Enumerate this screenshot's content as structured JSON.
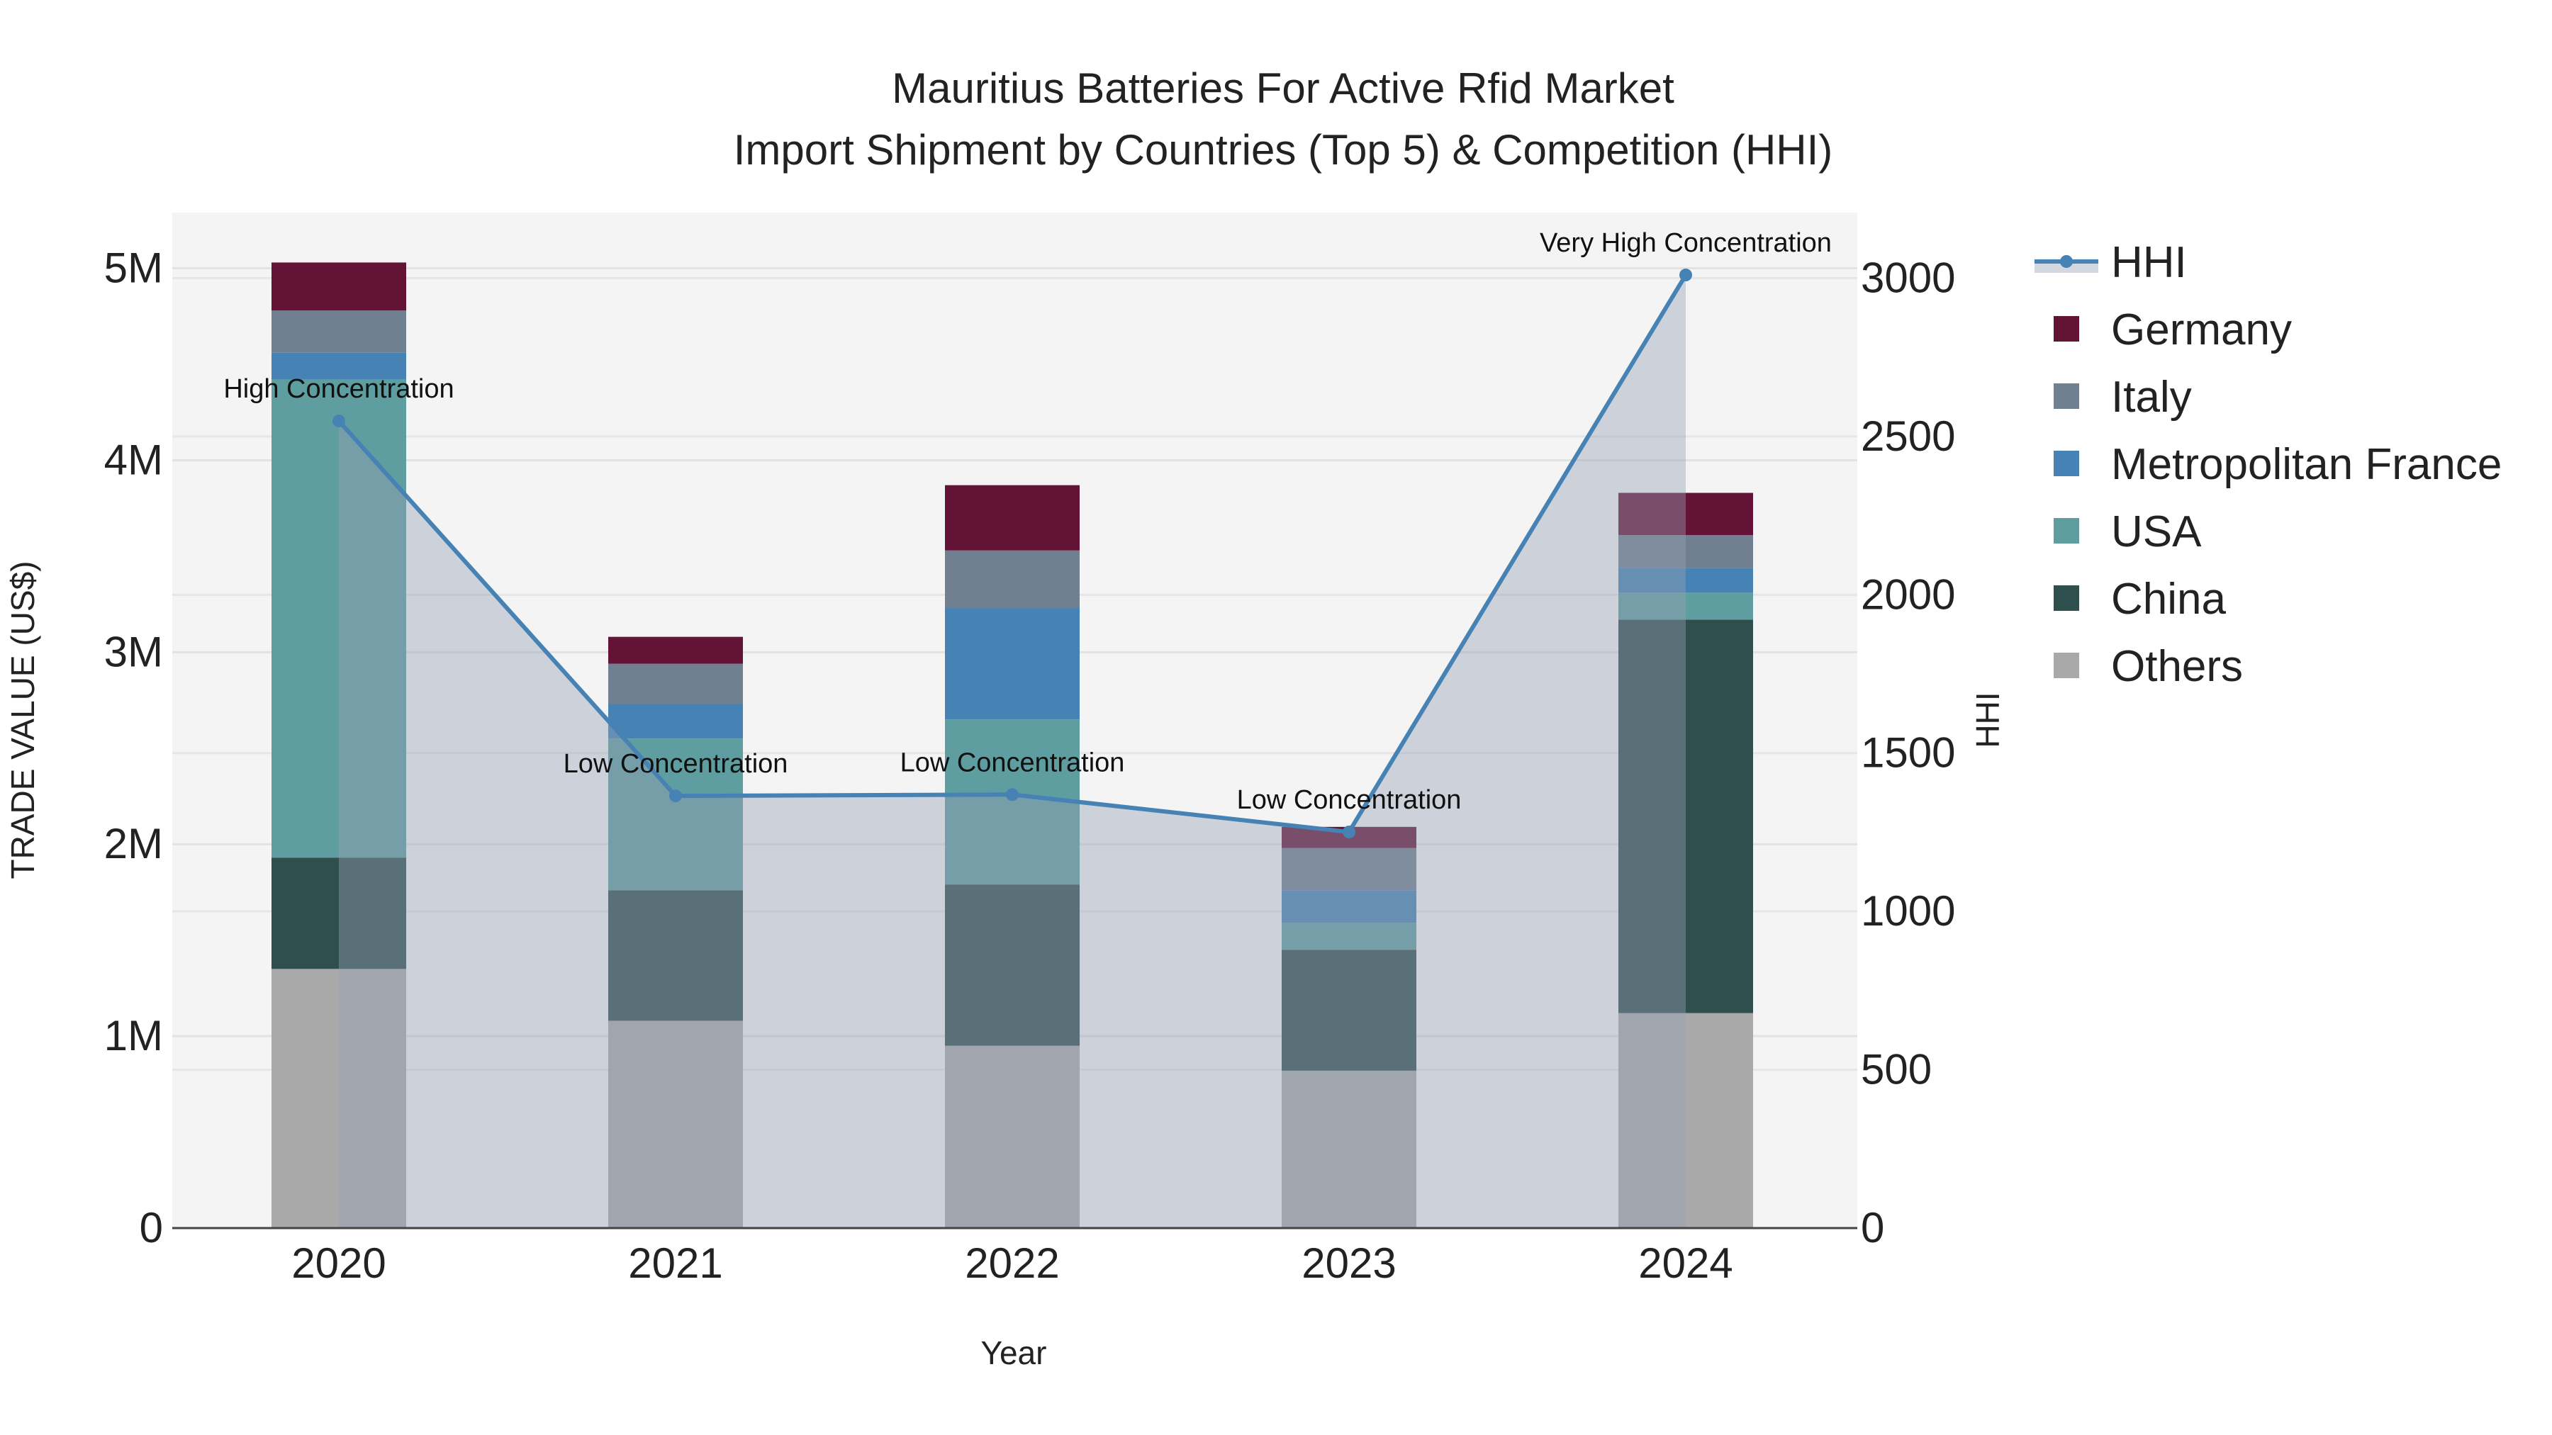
{
  "chart_data": {
    "type": "bar",
    "title": "Mauritius Batteries For Active Rfid Market",
    "subtitle": "Import Shipment by Countries (Top 5) & Competition (HHI)",
    "xlabel": "Year",
    "ylabel": "TRADE VALUE (US$)",
    "y2label": "HHI",
    "categories": [
      "2020",
      "2021",
      "2022",
      "2023",
      "2024"
    ],
    "ylim": [
      0,
      5290000
    ],
    "y2lim": [
      0,
      3207
    ],
    "yticks": [
      {
        "v": 0,
        "l": "0"
      },
      {
        "v": 1000000,
        "l": "1M"
      },
      {
        "v": 2000000,
        "l": "2M"
      },
      {
        "v": 3000000,
        "l": "3M"
      },
      {
        "v": 4000000,
        "l": "4M"
      },
      {
        "v": 5000000,
        "l": "5M"
      }
    ],
    "y2ticks": [
      {
        "v": 0,
        "l": "0"
      },
      {
        "v": 500,
        "l": "500"
      },
      {
        "v": 1000,
        "l": "1000"
      },
      {
        "v": 1500,
        "l": "1500"
      },
      {
        "v": 2000,
        "l": "2000"
      },
      {
        "v": 2500,
        "l": "2500"
      },
      {
        "v": 3000,
        "l": "3000"
      }
    ],
    "series": [
      {
        "name": "Others",
        "color": "#a9a9a9",
        "values": [
          1350000,
          1080000,
          950000,
          820000,
          1120000
        ]
      },
      {
        "name": "China",
        "color": "#2f4f4f",
        "values": [
          580000,
          680000,
          840000,
          630000,
          2050000
        ]
      },
      {
        "name": "USA",
        "color": "#5f9ea0",
        "values": [
          2490000,
          790000,
          860000,
          140000,
          140000
        ]
      },
      {
        "name": "Metropolitan France",
        "color": "#4682b4",
        "values": [
          140000,
          180000,
          580000,
          170000,
          130000
        ]
      },
      {
        "name": "Italy",
        "color": "#708090",
        "values": [
          220000,
          210000,
          300000,
          220000,
          170000
        ]
      },
      {
        "name": "Germany",
        "color": "#621336",
        "values": [
          250000,
          140000,
          340000,
          110000,
          220000
        ]
      }
    ],
    "hhi": {
      "name": "HHI",
      "color": "#4682b4",
      "values": [
        2549,
        1365,
        1369,
        1251,
        3010
      ],
      "labels": [
        "High Concentration",
        "Low Concentration",
        "Low Concentration",
        "Low Concentration",
        "Very High Concentration"
      ]
    },
    "legend_order": [
      "HHI",
      "Germany",
      "Italy",
      "Metropolitan France",
      "USA",
      "China",
      "Others"
    ],
    "legend_position": "right",
    "grid": true
  }
}
